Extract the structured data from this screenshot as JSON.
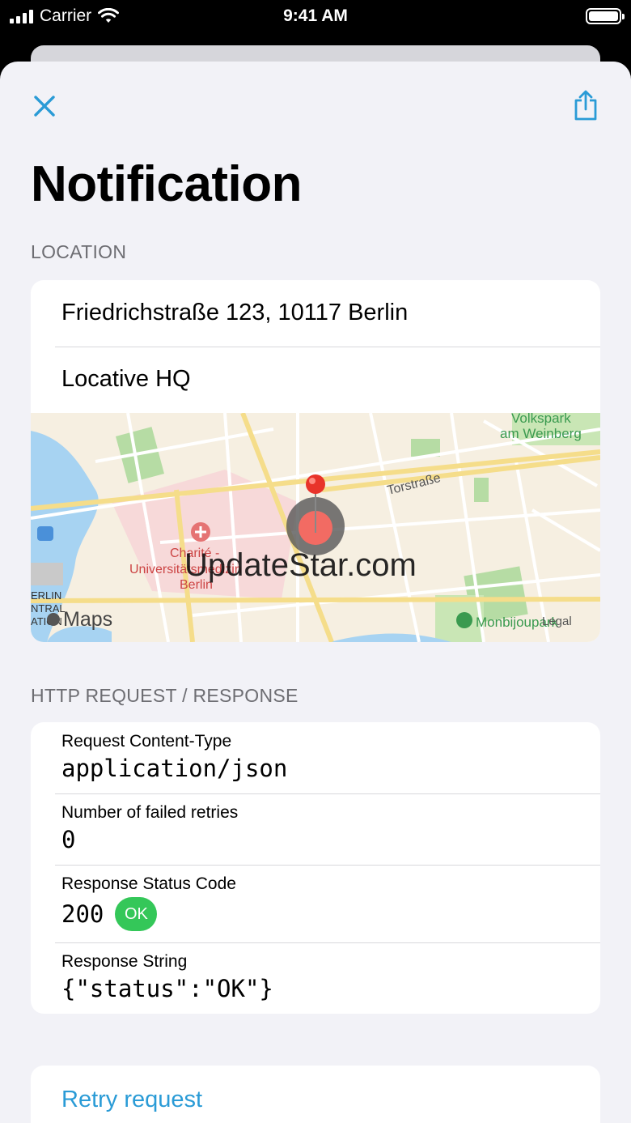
{
  "status_bar": {
    "carrier": "Carrier",
    "time": "9:41 AM"
  },
  "header": {
    "title": "Notification"
  },
  "location": {
    "section_title": "LOCATION",
    "address": "Friedrichstraße 123, 10117 Berlin",
    "name": "Locative HQ",
    "map": {
      "labels": {
        "volkspark_1": "Volkspark",
        "volkspark_2": "am Weinberg",
        "torstrasse": "Torstraße",
        "charite_1": "Charité -",
        "charite_2": "Universitätsmedizin",
        "charite_3": "Berlin",
        "berlin_central_1": "ERLIN",
        "berlin_central_2": "NTRAL",
        "berlin_central_3": "ATION",
        "monbijoupark": "Monbijoupark",
        "maps_logo": "Maps",
        "legal": "Legal",
        "watermark": "UpdateStar.com"
      }
    }
  },
  "http": {
    "section_title": "HTTP REQUEST / RESPONSE",
    "content_type_label": "Request Content-Type",
    "content_type_value": "application/json",
    "retries_label": "Number of failed retries",
    "retries_value": "0",
    "status_label": "Response Status Code",
    "status_value": "200",
    "status_badge": "OK",
    "response_label": "Response String",
    "response_value": "{\"status\":\"OK\"}"
  },
  "actions": {
    "retry_label": "Retry request"
  },
  "colors": {
    "tint": "#2a9bd6",
    "ok_green": "#34c759",
    "pin_red": "#e8332a"
  }
}
